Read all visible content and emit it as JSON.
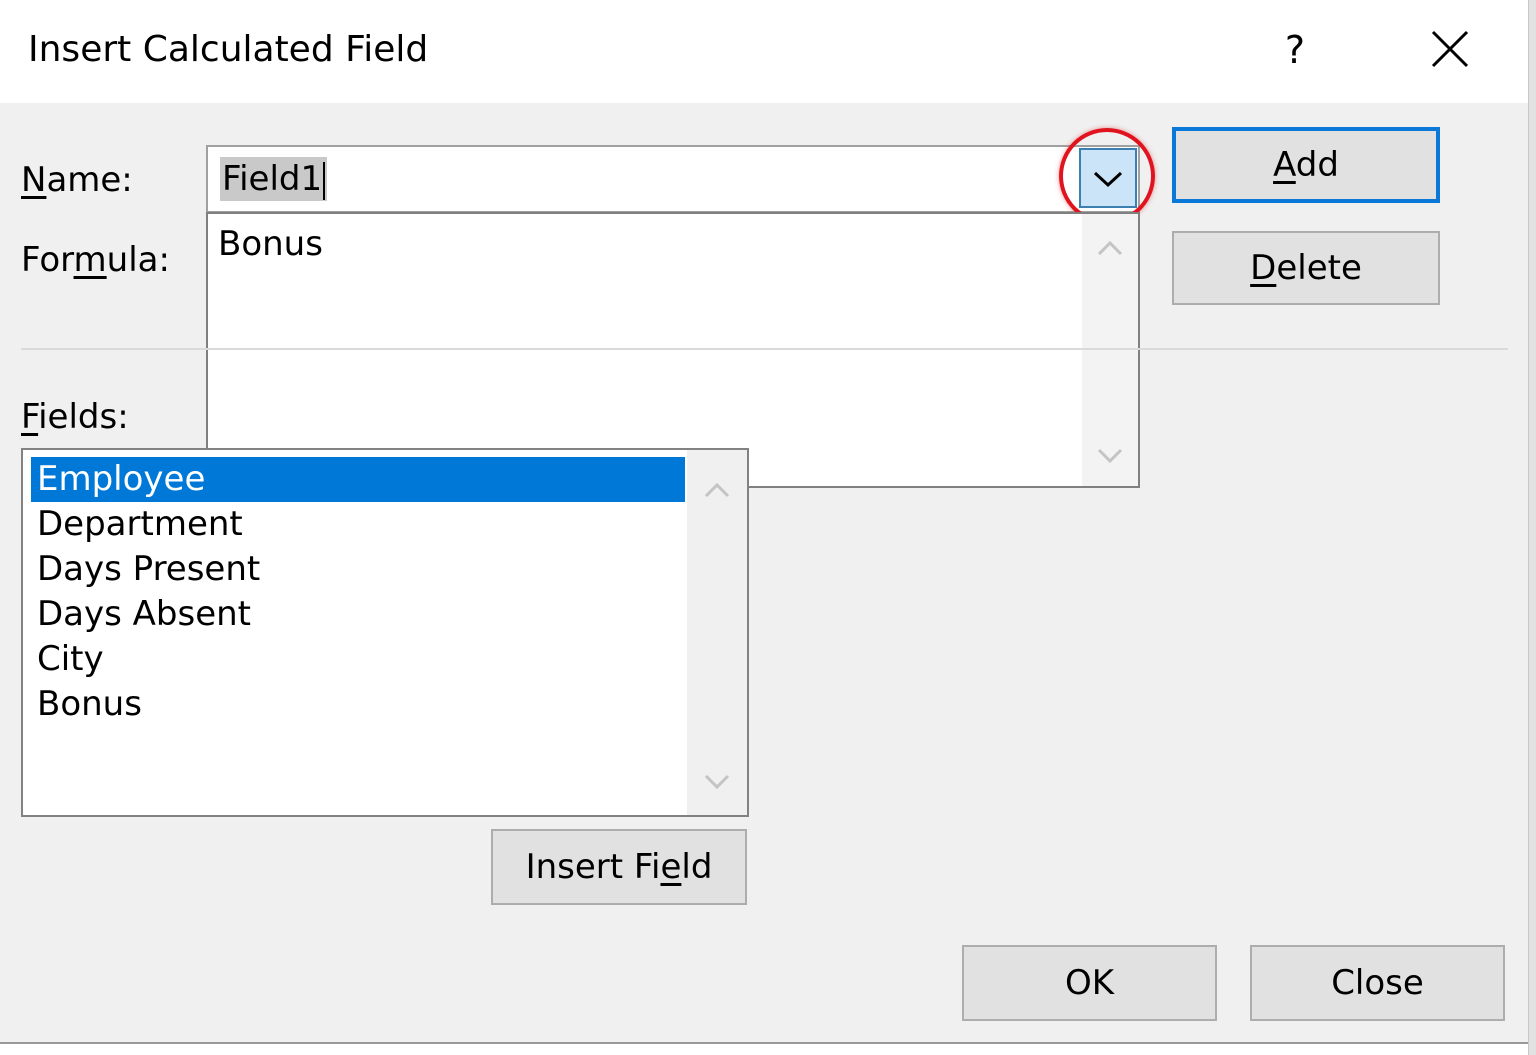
{
  "dialog": {
    "title": "Insert Calculated Field",
    "help": "?"
  },
  "name": {
    "label_prefix": "",
    "label_hotkey": "N",
    "label_suffix": "ame:",
    "value": "Field1",
    "dropdown_items": [
      "Bonus"
    ]
  },
  "formula": {
    "label_prefix": "For",
    "label_hotkey": "m",
    "label_suffix": "ula:"
  },
  "fields": {
    "label_prefix": "",
    "label_hotkey": "F",
    "label_suffix": "ields:",
    "items": [
      "Employee",
      "Department",
      "Days Present",
      "Days Absent",
      "City",
      "Bonus"
    ],
    "selected_index": 0
  },
  "buttons": {
    "add": {
      "prefix": "",
      "hotkey": "A",
      "suffix": "dd"
    },
    "delete": {
      "prefix": "",
      "hotkey": "D",
      "suffix": "elete"
    },
    "insert_field": {
      "prefix": "Insert Fi",
      "hotkey": "e",
      "suffix": "ld"
    },
    "ok": "OK",
    "close": "Close"
  },
  "colors": {
    "selection": "#0078d7",
    "default_button_border": "#0a78d7",
    "highlight_circle": "#e0141e"
  },
  "icons": {
    "close": "close-icon",
    "combo": "chevron-down-icon",
    "scroll_up": "chevron-up-icon",
    "scroll_down": "chevron-down-icon"
  }
}
